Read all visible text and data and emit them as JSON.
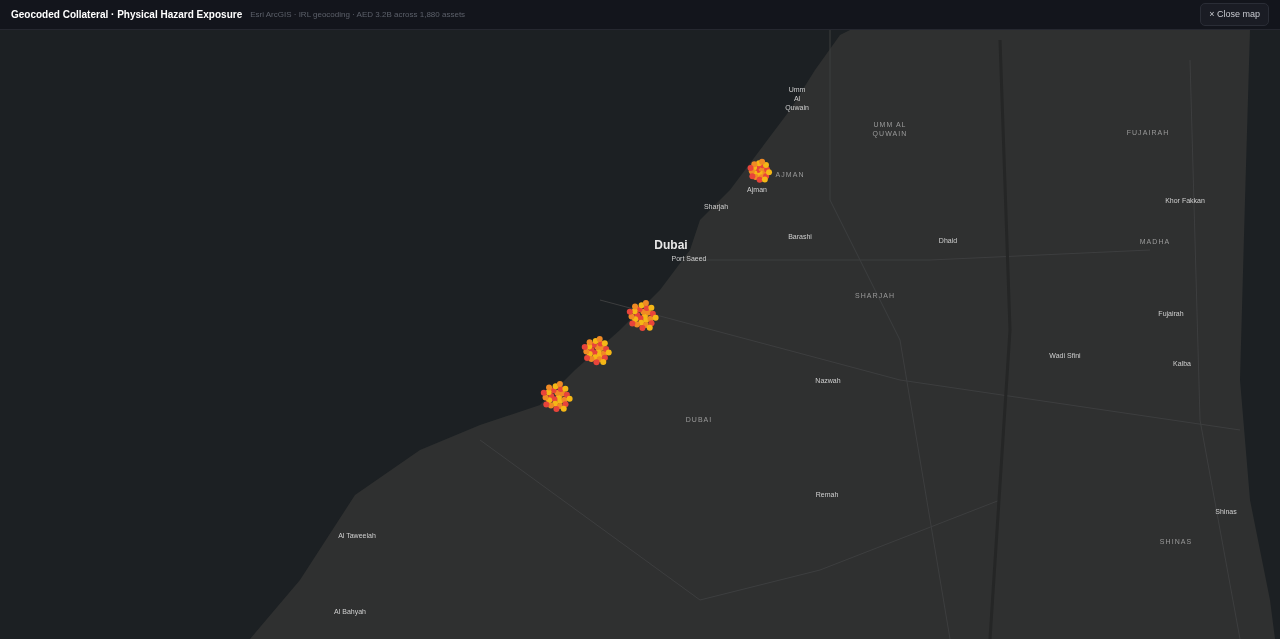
{
  "header": {
    "title": "Geocoded Collateral · Physical Hazard Exposure",
    "subtitle": "Esri ArcGIS · IRL geocoding · AED 3.2B across 1,880 assets",
    "close_button": "× Close map"
  },
  "map_labels": [
    {
      "text": "Umm Al Quwain",
      "kind": "city"
    },
    {
      "text": "UMM AL QUWAIN",
      "kind": "region"
    },
    {
      "text": "FUJAIRAH",
      "kind": "region"
    },
    {
      "text": "AJMAN",
      "kind": "region"
    },
    {
      "text": "Ajman",
      "kind": "city"
    },
    {
      "text": "Sharjah",
      "kind": "city"
    },
    {
      "text": "Khor Fakkan",
      "kind": "city"
    },
    {
      "text": "Dubai",
      "kind": "major"
    },
    {
      "text": "Port Saeed",
      "kind": "city"
    },
    {
      "text": "Barashi",
      "kind": "city"
    },
    {
      "text": "Dhaid",
      "kind": "city"
    },
    {
      "text": "MADHA",
      "kind": "region"
    },
    {
      "text": "SHARJAH",
      "kind": "region"
    },
    {
      "text": "Fujairah",
      "kind": "city"
    },
    {
      "text": "Wadi Sfini",
      "kind": "city"
    },
    {
      "text": "Kalba",
      "kind": "city"
    },
    {
      "text": "Nazwah",
      "kind": "city"
    },
    {
      "text": "DUBAI",
      "kind": "region"
    },
    {
      "text": "Remah",
      "kind": "city"
    },
    {
      "text": "Shinas",
      "kind": "city"
    },
    {
      "text": "SHINAS",
      "kind": "region"
    },
    {
      "text": "Al Taweelah",
      "kind": "city"
    },
    {
      "text": "Al Bahyah",
      "kind": "city"
    }
  ]
}
